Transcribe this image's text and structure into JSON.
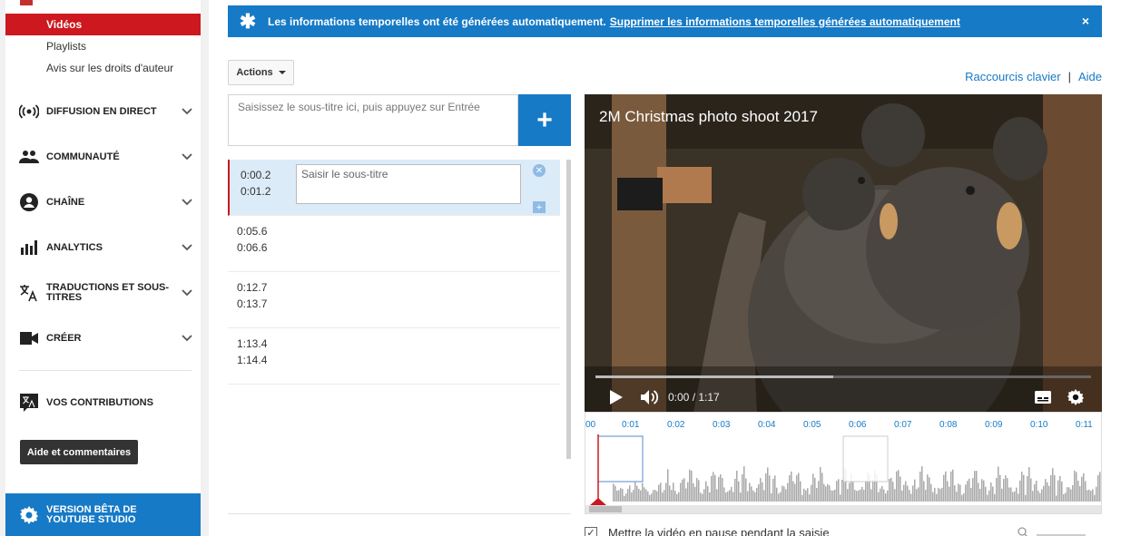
{
  "sidebar": {
    "sub_items": [
      {
        "label": "Vidéos",
        "active": true
      },
      {
        "label": "Playlists",
        "active": false
      },
      {
        "label": "Avis sur les droits d'auteur",
        "active": false
      }
    ],
    "sections": [
      {
        "label": "DIFFUSION EN DIRECT",
        "icon": "live-broadcast-icon"
      },
      {
        "label": "COMMUNAUTÉ",
        "icon": "community-icon"
      },
      {
        "label": "CHAÎNE",
        "icon": "channel-icon"
      },
      {
        "label": "ANALYTICS",
        "icon": "analytics-icon"
      },
      {
        "label": "TRADUCTIONS ET SOUS-TITRES",
        "icon": "translate-icon"
      },
      {
        "label": "CRÉER",
        "icon": "video-camera-icon"
      }
    ],
    "contributions": "VOS CONTRIBUTIONS",
    "help_button": "Aide et commentaires",
    "beta": "VERSION BÊTA DE YOUTUBE STUDIO"
  },
  "banner": {
    "text": "Les informations temporelles ont été générées automatiquement.",
    "link": "Supprimer les informations temporelles générées automatiquement",
    "close": "×"
  },
  "toolbar": {
    "actions": "Actions",
    "shortcuts": "Raccourcis clavier",
    "separator": "|",
    "help": "Aide"
  },
  "entry": {
    "placeholder": "Saisissez le sous-titre ici, puis appuyez sur Entrée",
    "add": "+"
  },
  "cues": [
    {
      "start": "0:00.2",
      "end": "0:01.2",
      "text_placeholder": "Saisir le sous-titre",
      "active": true
    },
    {
      "start": "0:05.6",
      "end": "0:06.6",
      "active": false
    },
    {
      "start": "0:12.7",
      "end": "0:13.7",
      "active": false
    },
    {
      "start": "1:13.4",
      "end": "1:14.4",
      "active": false
    }
  ],
  "video": {
    "title": "2M Christmas photo shoot 2017",
    "time": "0:00 / 1:17"
  },
  "timeline": {
    "ticks": [
      "00",
      "0:01",
      "0:02",
      "0:03",
      "0:04",
      "0:05",
      "0:06",
      "0:07",
      "0:08",
      "0:09",
      "0:10",
      "0:11"
    ]
  },
  "pause_option": {
    "label": "Mettre la vidéo en pause pendant la saisie",
    "checked": true
  },
  "colors": {
    "accent_blue": "#167ac6",
    "active_red": "#cc181e"
  }
}
